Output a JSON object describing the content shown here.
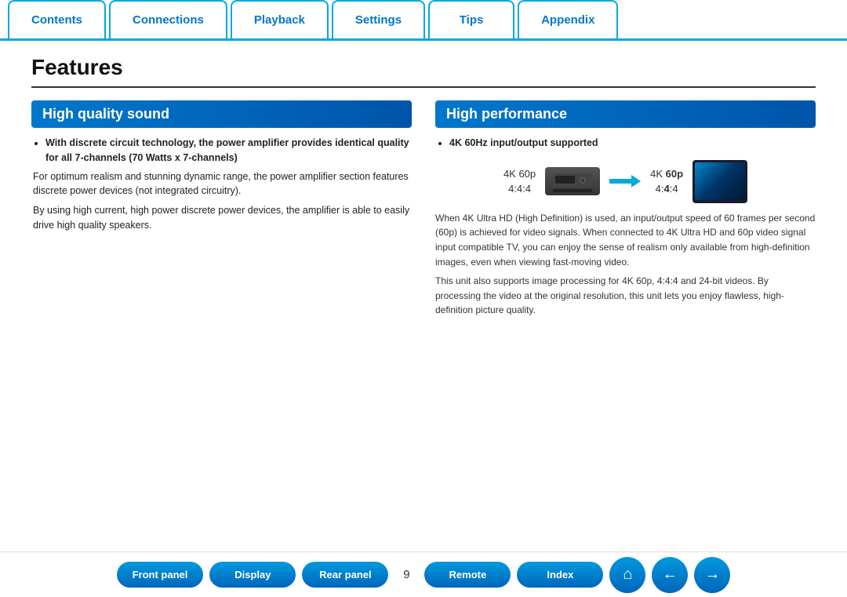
{
  "nav": {
    "tabs": [
      {
        "label": "Contents"
      },
      {
        "label": "Connections"
      },
      {
        "label": "Playback"
      },
      {
        "label": "Settings"
      },
      {
        "label": "Tips"
      },
      {
        "label": "Appendix"
      }
    ]
  },
  "page": {
    "title": "Features"
  },
  "left_section": {
    "header": "High quality sound",
    "bullet_bold": "With discrete circuit technology, the power amplifier provides identical quality for all 7-channels (70 Watts x 7-channels)",
    "para1": "For optimum realism and stunning dynamic range, the power amplifier section features discrete power devices (not integrated circuitry).",
    "para2": "By using high current, high power discrete power devices, the amplifier is able to easily drive high quality speakers."
  },
  "right_section": {
    "header": "High performance",
    "bullet_bold": "4K 60Hz input/output supported",
    "diagram": {
      "source_label1": "4K 60p",
      "source_label2": "4:4:4",
      "dest_label1": "4K 60p",
      "dest_label2": "4:4:4",
      "dest_bold": true
    },
    "desc1": "When 4K Ultra HD (High Definition) is used, an input/output speed of 60 frames per second (60p) is achieved for video signals. When connected to 4K Ultra HD and 60p video signal input compatible TV, you can enjoy the sense of realism only available from high-definition images, even when viewing fast-moving video.",
    "desc2": "This unit also supports image processing for 4K 60p, 4:4:4 and 24-bit videos. By processing the video at the original resolution, this unit lets you enjoy flawless, high-definition picture quality."
  },
  "bottom_nav": {
    "buttons": [
      {
        "label": "Front panel"
      },
      {
        "label": "Display"
      },
      {
        "label": "Rear panel"
      },
      {
        "label": "Remote"
      },
      {
        "label": "Index"
      }
    ],
    "page_number": "9",
    "icons": [
      "home",
      "back",
      "forward"
    ]
  }
}
